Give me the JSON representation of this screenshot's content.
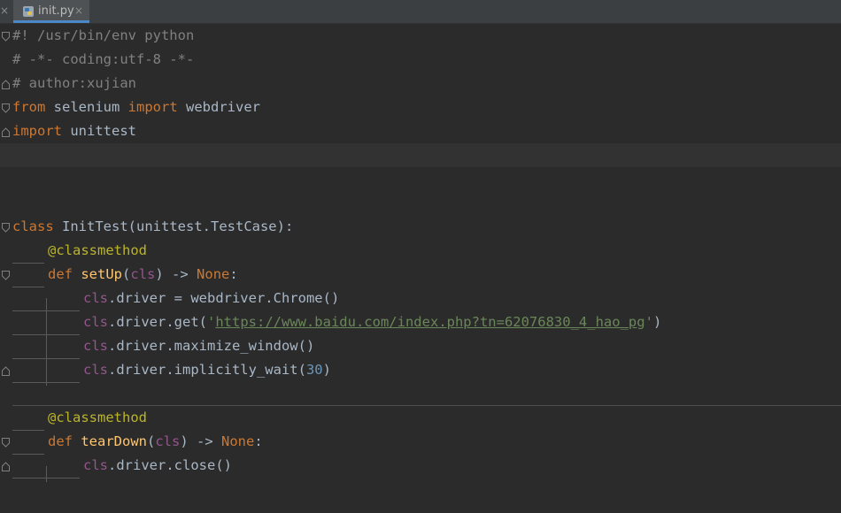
{
  "tab": {
    "label": "init.py",
    "close": "×",
    "left_close": "×"
  },
  "code": {
    "l1": "#! /usr/bin/env python",
    "l2": "# -*- coding:utf-8 -*-",
    "l3": "# author:xujian",
    "l4": {
      "kw_from": "from",
      "mod": "selenium",
      "kw_import": "import",
      "name": "webdriver"
    },
    "l5": {
      "kw_import": "import",
      "name": "unittest"
    },
    "l9": {
      "kw_class": "class",
      "rest": "InitTest(unittest.TestCase):"
    },
    "l10": "@classmethod",
    "l11": {
      "kw_def": "def",
      "fn": "setUp",
      "open": "(",
      "param": "cls",
      "arrow": ") -> ",
      "ret": "None",
      "colon": ":"
    },
    "l12": {
      "self": "cls",
      "rest": ".driver = webdriver.Chrome()"
    },
    "l13": {
      "self": "cls",
      "pre": ".driver.get(",
      "q1": "'",
      "url": "https://www.baidu.com/index.php?tn=62076830_4_hao_pg",
      "q2": "'",
      "post": ")"
    },
    "l14": {
      "self": "cls",
      "rest": ".driver.maximize_window()"
    },
    "l15": {
      "self": "cls",
      "pre": ".driver.implicitly_wait(",
      "num": "30",
      "post": ")"
    },
    "l17": "@classmethod",
    "l18": {
      "kw_def": "def",
      "fn": "tearDown",
      "open": "(",
      "param": "cls",
      "arrow": ") -> ",
      "ret": "None",
      "colon": ":"
    },
    "l19": {
      "self": "cls",
      "rest": ".driver.close()"
    }
  },
  "colors": {
    "background": "#2b2b2b",
    "keyword": "#cc7832",
    "decorator": "#bbb529",
    "function": "#ffc66d",
    "self_param": "#94558d",
    "string": "#6a8759",
    "number": "#6897bb",
    "comment": "#808080",
    "text": "#a9b7c6"
  },
  "icons": [
    "python-file-icon",
    "close-icon",
    "fold-icon"
  ]
}
